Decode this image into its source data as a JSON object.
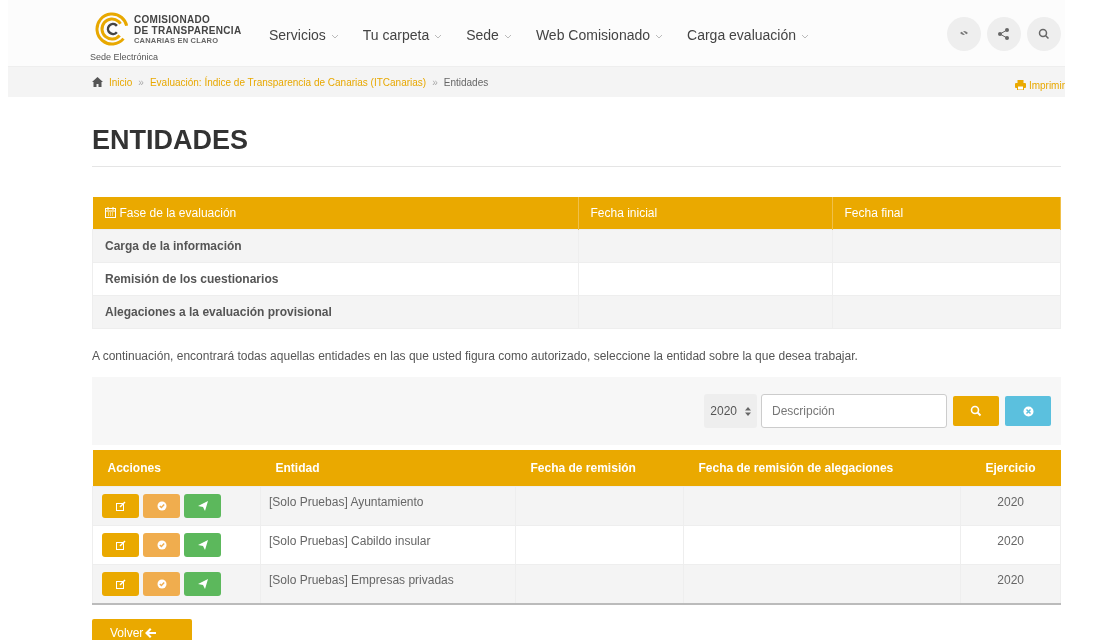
{
  "header": {
    "logo": {
      "line_1": "COMISIONADO",
      "line_2": "DE TRANSPARENCIA",
      "line_3": "CANARIAS EN CLARO"
    },
    "subtitle": "Sede Electrónica",
    "nav": [
      {
        "label": "Servicios"
      },
      {
        "label": "Tu carpeta"
      },
      {
        "label": "Sede"
      },
      {
        "label": "Web Comisionado"
      },
      {
        "label": "Carga evaluación"
      }
    ]
  },
  "breadcrumb": {
    "separators": [
      "»",
      "»"
    ],
    "links": [
      "Inicio",
      "Evaluación: Índice de Transparencia de Canarias (ITCanarias)"
    ],
    "current": "Entidades",
    "print": "Imprimir"
  },
  "title": "ENTIDADES",
  "phases": {
    "columns": [
      "Fase de la evaluación",
      "Fecha inicial",
      "Fecha final"
    ],
    "rows": [
      {
        "phase": "Carga de la información"
      },
      {
        "phase": "Remisión de los cuestionarios"
      },
      {
        "phase": "Alegaciones a la evaluación provisional"
      }
    ]
  },
  "intro": "A continuación, encontrará todas aquellas entidades en las que usted figura como autorizado, seleccione la entidad sobre la que desea trabajar.",
  "filter": {
    "year": "2020",
    "placeholder": "Descripción"
  },
  "entities": {
    "columns": [
      "Acciones",
      "Entidad",
      "Fecha de remisión",
      "Fecha de remisión de alegaciones",
      "Ejercicio"
    ],
    "rows": [
      {
        "entity": "[Solo Pruebas] Ayuntamiento",
        "year": "2020"
      },
      {
        "entity": "[Solo Pruebas] Cabildo insular",
        "year": "2020"
      },
      {
        "entity": "[Solo Pruebas] Empresas privadas",
        "year": "2020"
      }
    ]
  },
  "back_button": "Volver"
}
